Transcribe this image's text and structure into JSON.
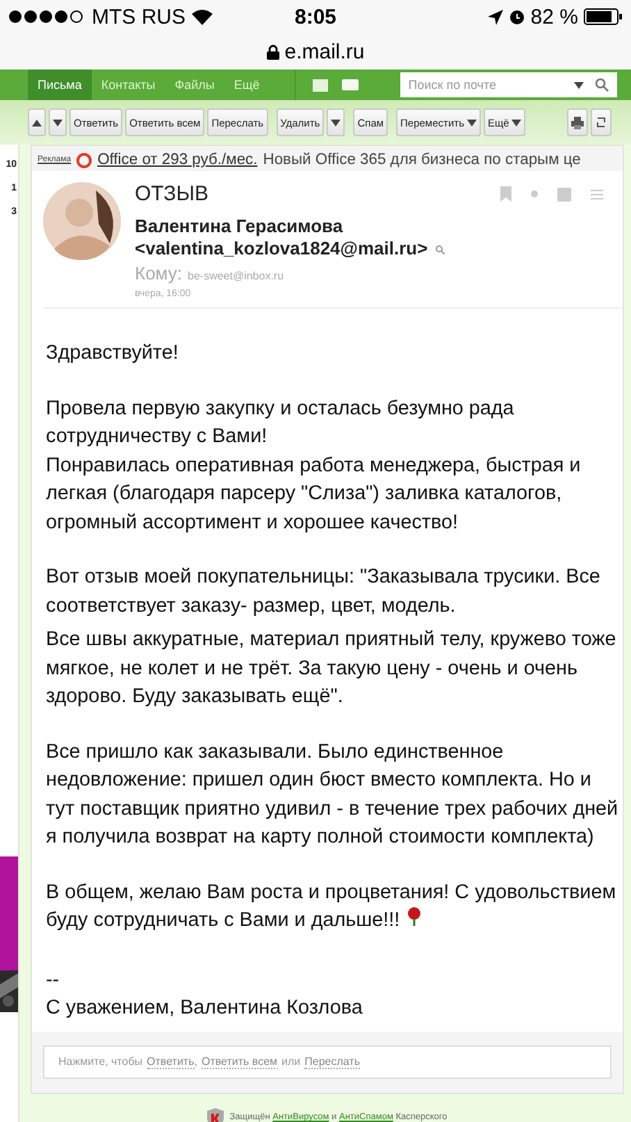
{
  "status_bar": {
    "carrier": "MTS RUS",
    "time": "8:05",
    "battery": "82 %"
  },
  "address_bar": {
    "url": "e.mail.ru"
  },
  "nav": {
    "tabs": [
      {
        "label": "Письма",
        "selected": true
      },
      {
        "label": "Контакты",
        "selected": false
      },
      {
        "label": "Файлы",
        "selected": false
      },
      {
        "label": "Ещё",
        "selected": false
      }
    ],
    "search": {
      "placeholder": "Поиск по почте"
    }
  },
  "toolbar": {
    "buttons": [
      {
        "kind": "up"
      },
      {
        "kind": "down"
      },
      {
        "kind": "text",
        "label": "Ответить"
      },
      {
        "kind": "text",
        "label": "Ответить всем"
      },
      {
        "kind": "text",
        "label": "Переслать"
      },
      {
        "kind": "text",
        "label": "Удалить"
      },
      {
        "kind": "caret"
      },
      {
        "kind": "text",
        "label": "Спам"
      },
      {
        "kind": "menu",
        "label": "Переместить"
      },
      {
        "kind": "menu",
        "label": "Ещё"
      }
    ]
  },
  "sidebar": {
    "counts": [
      "10",
      "1",
      "3"
    ]
  },
  "ad": {
    "label": "Реклама",
    "link": "Office от 293 руб./мес.",
    "text": "Новый Office 365 для бизнеса по старым це"
  },
  "message": {
    "subject": "ОТЗЫВ",
    "sender_name": "Валентина Герасимова",
    "sender_email": "<valentina_kozlova1824@mail.ru>",
    "to_label": "Кому:",
    "to": "be-sweet@inbox.ru",
    "date": "вчера, 16:00",
    "body": [
      [
        "Здравствуйте!"
      ],
      [
        "Провела первую закупку и осталась безумно рада сотрудничеству с Вами!",
        "Понравилась оперативная работа менеджера, быстрая и легкая (благодаря парсеру \"Слиза\") заливка каталогов, огромный ассортимент и хорошее качество!"
      ],
      [
        "Вот отзыв моей покупательницы: \"Заказывала трусики. Все соответствует заказу- размер, цвет, модель."
      ],
      [
        "Все швы аккуратные, материал приятный телу, кружево тоже мягкое, не колет и не трёт. За такую цену - очень и очень здорово. Буду заказывать ещё\"."
      ],
      [
        "Все пришло как заказывали. Было единственное недовложение: пришел один бюст вместо комплекта. Но и тут поставщик приятно удивил - в течение трех рабочих дней я получила возврат на карту полной стоимости комплекта)"
      ],
      [
        "В общем, желаю Вам роста и процветания! С удовольствием буду сотрудничать с Вами и дальше!!!"
      ],
      [
        "--",
        "С уважением, Валентина Козлова"
      ]
    ]
  },
  "reply": {
    "prefix": "Нажмите, чтобы",
    "actions": [
      "Ответить",
      "Ответить всем",
      "Переслать"
    ],
    "separators": [
      ",",
      "или"
    ]
  },
  "footer": {
    "before": "Защищён",
    "link1": "АнтиВирусом",
    "middle": "и",
    "link2": "АнтиСпамом",
    "after": "Касперского"
  }
}
